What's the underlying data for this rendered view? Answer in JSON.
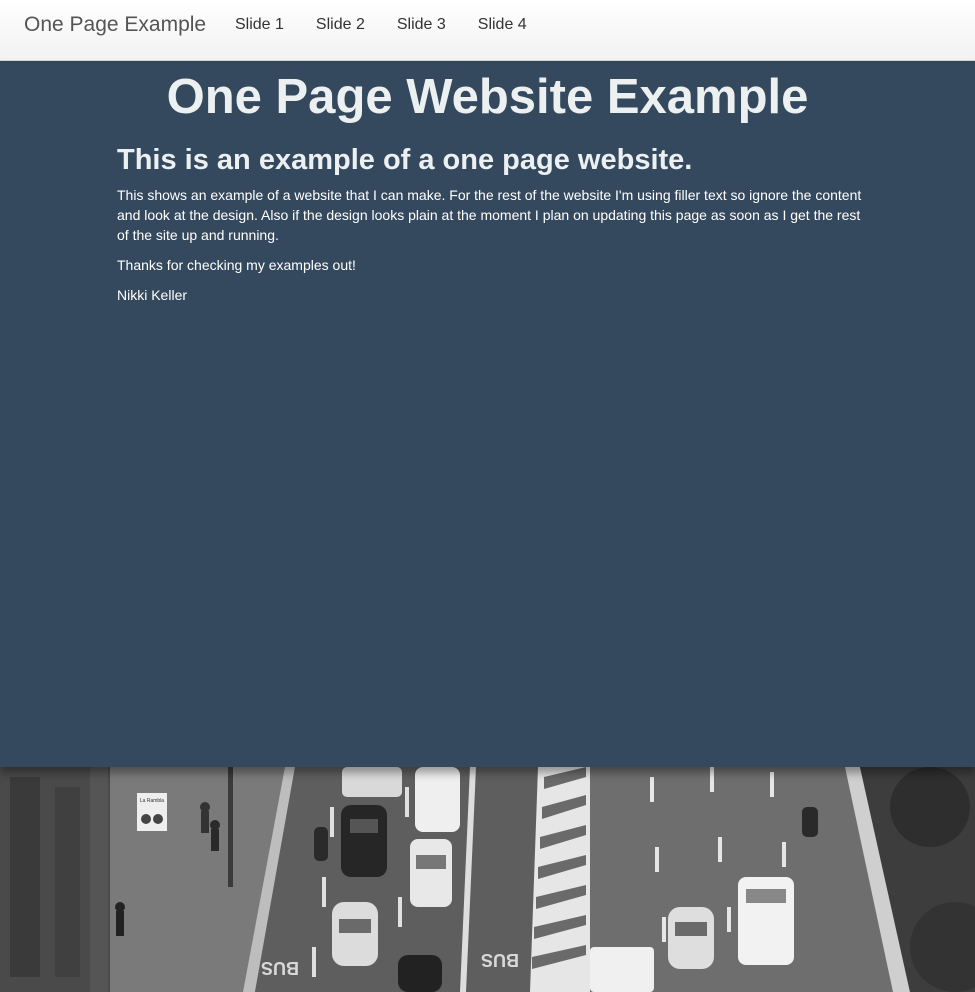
{
  "navbar": {
    "brand": "One Page Example",
    "links": [
      "Slide 1",
      "Slide 2",
      "Slide 3",
      "Slide 4"
    ]
  },
  "hero": {
    "title": "One Page Website Example",
    "subtitle": "This is an example of a one page website.",
    "paragraphs": [
      "This shows an example of a website that I can make. For the rest of the website I'm using filler text so ignore the content and look at the design. Also if the design looks plain at the moment I plan on updating this page as soon as I get the rest of the site up and running.",
      "Thanks for checking my examples out!",
      "Nikki Keller"
    ]
  },
  "photo": {
    "road_markings": [
      "BUS",
      "BUS"
    ],
    "sign_text": "La Rambla"
  },
  "colors": {
    "hero_background": "#34495e",
    "hero_text": "#ecf0f1",
    "navbar_background": "#f8f8f8"
  }
}
